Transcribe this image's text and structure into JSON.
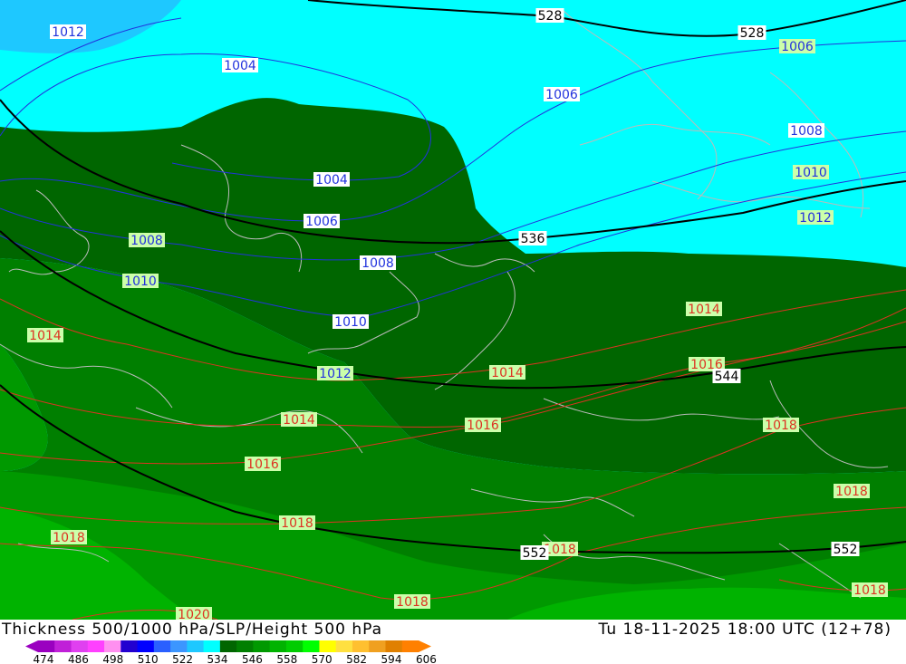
{
  "title": "Thickness 500/1000 hPa/SLP/Height 500 hPa",
  "valid_time": "Tu 18-11-2025 18:00 UTC (12+78)",
  "colors": {
    "band_522": "#1ec8ff",
    "band_528": "#00ffff",
    "band_534": "#006600",
    "band_540": "#007f00",
    "band_546": "#009900",
    "band_552": "#00b300",
    "slp_low_isobar": "#2233dd",
    "slp_high_isobar": "#dd3322",
    "height_contour": "#000000",
    "coastline": "#bbbbbb"
  },
  "map": {
    "slp_labels": [
      {
        "text": "1012",
        "cls": "blue"
      },
      {
        "text": "1004",
        "cls": "blue"
      },
      {
        "text": "1006",
        "cls": "blue"
      },
      {
        "text": "1006",
        "cls": "green"
      },
      {
        "text": "1008",
        "cls": "blue"
      },
      {
        "text": "1010",
        "cls": "green"
      },
      {
        "text": "1012",
        "cls": "green"
      },
      {
        "text": "1004",
        "cls": "blue"
      },
      {
        "text": "1006",
        "cls": "blue"
      },
      {
        "text": "1008",
        "cls": "green"
      },
      {
        "text": "1008",
        "cls": "blue"
      },
      {
        "text": "1010",
        "cls": "green"
      },
      {
        "text": "1010",
        "cls": "blue"
      },
      {
        "text": "1012",
        "cls": "green"
      },
      {
        "text": "1014",
        "cls": "red"
      },
      {
        "text": "1014",
        "cls": "red"
      },
      {
        "text": "1014",
        "cls": "red"
      },
      {
        "text": "1014",
        "cls": "red"
      },
      {
        "text": "1016",
        "cls": "red"
      },
      {
        "text": "1016",
        "cls": "red"
      },
      {
        "text": "1016",
        "cls": "red"
      },
      {
        "text": "1018",
        "cls": "red"
      },
      {
        "text": "1018",
        "cls": "red"
      },
      {
        "text": "1018",
        "cls": "red"
      },
      {
        "text": "1018",
        "cls": "red"
      },
      {
        "text": "1018",
        "cls": "red"
      },
      {
        "text": "1018",
        "cls": "red"
      },
      {
        "text": "1018",
        "cls": "red"
      },
      {
        "text": "1020",
        "cls": "red"
      }
    ],
    "height_labels": [
      "528",
      "528",
      "536",
      "544",
      "552",
      "552"
    ]
  },
  "scale": {
    "ticks": [
      "474",
      "486",
      "498",
      "510",
      "522",
      "534",
      "546",
      "558",
      "570",
      "582",
      "594",
      "606"
    ],
    "colors": [
      "#9a00c0",
      "#c020d8",
      "#e040f0",
      "#ff40ff",
      "#ff90f0",
      "#2200d0",
      "#0000ff",
      "#2a60ff",
      "#3c96ff",
      "#1ec8ff",
      "#00ffff",
      "#006600",
      "#007f00",
      "#009900",
      "#00b300",
      "#00cc00",
      "#00ff00",
      "#ffff00",
      "#ffe040",
      "#ffc030",
      "#f0a020",
      "#e08000",
      "#ff8000"
    ]
  }
}
